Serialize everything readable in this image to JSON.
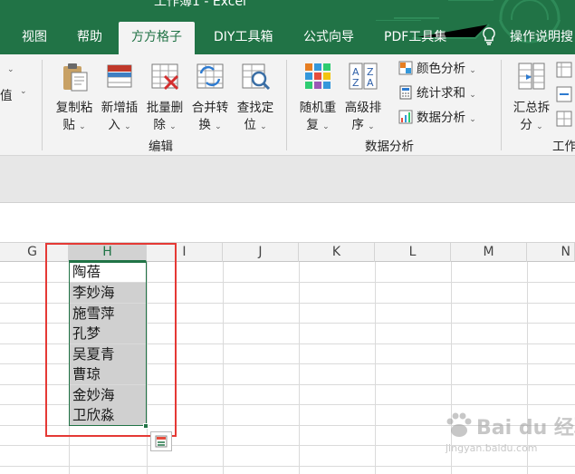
{
  "window": {
    "title": "工作簿1  -  Excel"
  },
  "tabs": [
    {
      "label": "视图",
      "active": false
    },
    {
      "label": "帮助",
      "active": false
    },
    {
      "label": "方方格子",
      "active": true
    },
    {
      "label": "DIY工具箱",
      "active": false
    },
    {
      "label": "公式向导",
      "active": false
    },
    {
      "label": "PDF工具集",
      "active": false
    },
    {
      "label": "操作说明搜",
      "active": false
    }
  ],
  "ribbon": {
    "left_partial": {
      "label": "值"
    },
    "edit_group": {
      "label": "编辑",
      "buttons": [
        {
          "line1": "复制粘",
          "line2": "贴"
        },
        {
          "line1": "新增插",
          "line2": "入"
        },
        {
          "line1": "批量删",
          "line2": "除"
        },
        {
          "line1": "合并转",
          "line2": "换"
        },
        {
          "line1": "查找定",
          "line2": "位"
        }
      ]
    },
    "analysis_group": {
      "label": "数据分析",
      "buttons": [
        {
          "line1": "随机重",
          "line2": "复"
        },
        {
          "line1": "高级排",
          "line2": "序"
        }
      ],
      "small_items": [
        {
          "label": "颜色分析"
        },
        {
          "label": "统计求和"
        },
        {
          "label": "数据分析"
        }
      ]
    },
    "right_group": {
      "label": "工作",
      "buttons": [
        {
          "line1": "汇总拆",
          "line2": "分"
        }
      ]
    }
  },
  "grid": {
    "columns": [
      "G",
      "H",
      "I",
      "J",
      "K",
      "L",
      "M",
      "N"
    ],
    "selected_column": "H",
    "cells": [
      "陶蓓",
      "李妙海",
      "施雪萍",
      "孔梦",
      "吴夏青",
      "曹琼",
      "金妙海",
      "卫欣淼"
    ]
  },
  "watermark": {
    "text": "Bai du 经验",
    "sub": "jingyan.baidu.com"
  },
  "colors": {
    "accent": "#217346",
    "highlight": "#e53935",
    "selection_fill": "#d0d0d0"
  }
}
